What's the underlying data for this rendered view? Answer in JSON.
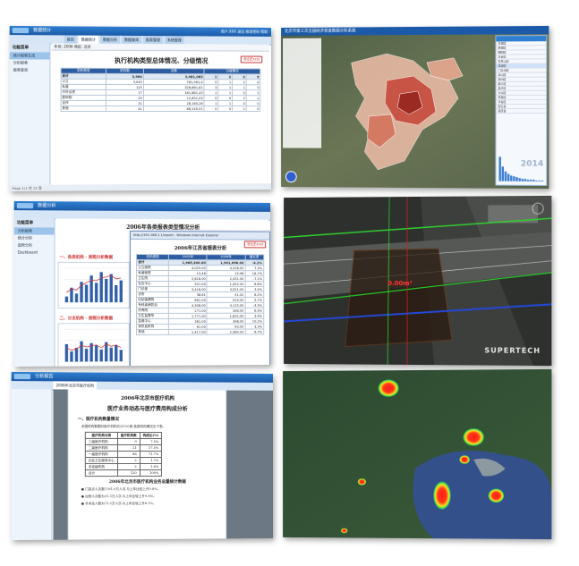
{
  "panel1": {
    "app_title": "数据统计",
    "header_links": "用户:XXX  退出  修改密码  帮助",
    "tabs": [
      "首页",
      "数据统计",
      "数据分析",
      "数据查询",
      "报表管理",
      "系统管理"
    ],
    "sidebar_head": "功能菜单",
    "sidebar_items": [
      "统计报表生成",
      "分析报表",
      "报表查询"
    ],
    "toolbar": "年份: 2006  地区: 北京",
    "report_title": "执行机构类型总体情况、分级情况",
    "export_label": "导出Excel",
    "col_headers": [
      "机构类型",
      "机构数",
      "总数",
      "分级情况",
      "",
      "",
      ""
    ],
    "rows": [
      [
        "合计",
        "3,964",
        "3,981,063",
        "1",
        "2",
        "3",
        "5"
      ],
      [
        "公立",
        "3,045",
        "781,581,4",
        "0",
        "1",
        "2",
        "4"
      ],
      [
        "私营",
        "125",
        "328,861,81",
        "3",
        "1",
        "1",
        "0"
      ],
      [
        "中外合资",
        "17",
        "161,881,43",
        "1",
        "1",
        "0",
        "1"
      ],
      [
        "股份制",
        "25",
        "12,831,03",
        "0",
        "0",
        "2",
        "1"
      ],
      [
        "合作",
        "31",
        "28,160,26",
        "1",
        "1",
        "0",
        "0"
      ],
      [
        "其他",
        "41",
        "88,140,01",
        "0",
        "0",
        "1",
        "0"
      ]
    ],
    "status": "Page 1/1  共 15 条"
  },
  "panel2": {
    "title": "北京市第三次全国经济普查数据分析系统",
    "year": "2014",
    "list_rows": [
      "东城区",
      "西城区",
      "朝阳区",
      "丰台区",
      "石景山区",
      "海淀区",
      "门头沟区",
      "房山区",
      "通州区",
      "顺义区",
      "昌平区",
      "大兴区",
      "怀柔区",
      "平谷区",
      "密云县",
      "延庆县"
    ]
  },
  "panel3": {
    "app_title": "数据分析",
    "sidebar_head": "功能菜单",
    "sidebar_items": [
      "分析报表",
      "统计分析",
      "趋势分析",
      "Dashboard"
    ],
    "main_title": "2006年各类报表类型情况分析",
    "section1": "一、各类机构 - 按照分析数据",
    "section2": "二、分支机构 - 按照分析数据",
    "overlay_bar": "http://192.168.1.1/report - Windows Internet Explorer",
    "overlay_title": "2006年江苏省报表分析",
    "export_label": "导出Excel",
    "overlay_headers": [
      "机构类型",
      "2005年",
      "2006年",
      "增长率"
    ],
    "overlay_rows": [
      [
        "合计",
        "1,985,300.00",
        "1,901,098.00",
        "-4.2%"
      ],
      [
        "公立医院",
        "4,025.00",
        "4,318.00",
        "7.3%"
      ],
      [
        "私营医院",
        "13.46",
        "15.98",
        "18.7%"
      ],
      [
        "卫生院",
        "2,618.00",
        "2,431.00",
        "-7.1%"
      ],
      [
        "社区中心",
        "921.00",
        "1,002.00",
        "8.8%"
      ],
      [
        "门诊部",
        "3,418.00",
        "3,521.00",
        "3.0%"
      ],
      [
        "诊所",
        "38.61",
        "41.02",
        "6.2%"
      ],
      [
        "妇幼保健院",
        "861.00",
        "910.00",
        "5.7%"
      ],
      [
        "专科疾病防治",
        "4,308.00",
        "4,115.00",
        "-4.5%"
      ],
      [
        "疗养院",
        "271.00",
        "288.00",
        "6.3%"
      ],
      [
        "卫生监督所",
        "1,771.00",
        "1,832.00",
        "3.4%"
      ],
      [
        "急救中心",
        "361.00",
        "398.00",
        "10.2%"
      ],
      [
        "采供血机构",
        "61.00",
        "63.00",
        "3.3%"
      ],
      [
        "其他",
        "2,417.00",
        "2,580.00",
        "6.7%"
      ]
    ],
    "chart1_values": [
      12,
      30,
      18,
      42,
      36,
      55,
      40,
      62,
      48,
      58,
      35,
      45
    ],
    "chart1_line": [
      20,
      28,
      25,
      35,
      40,
      46,
      44,
      50,
      52,
      55,
      48,
      50
    ],
    "chart2_values": [
      38,
      22,
      30,
      44,
      28,
      40,
      35,
      26,
      42,
      30,
      36,
      25
    ],
    "chart2_line": [
      30,
      25,
      28,
      35,
      32,
      34,
      36,
      30,
      38,
      33,
      35,
      30
    ]
  },
  "panel4": {
    "measure_label": "0.00m²",
    "brand": "SUPERTECH"
  },
  "panel5": {
    "app_title": "分析报告",
    "tab_label": "2006年北京市医疗机构",
    "title1": "2006年北京市医疗机构",
    "title2": "医疗业务动态与医疗费用构成分析",
    "section1": "一、医疗机构数量情况",
    "para1": "全国机构数据对医疗机构共计120家,各类机构情况见下表。",
    "table_headers": [
      "医疗机构分类",
      "医疗机构数",
      "构成比(%)"
    ],
    "table_rows": [
      [
        "三级医疗机构",
        "9",
        "7.5%"
      ],
      [
        "二级医疗机构",
        "21",
        "17.5%"
      ],
      [
        "一级医疗机构",
        "86",
        "71.7%"
      ],
      [
        "社区卫生服务中心",
        "2",
        "1.7%"
      ],
      [
        "未定级机构",
        "2",
        "1.6%"
      ],
      [
        "合计",
        "120",
        "100%"
      ]
    ],
    "section2": "2006年北京市医疗机构业务总量统计数据",
    "bullets": [
      "门急诊人次数1761.0万人次,与上年比较上升5.8%。",
      "出院人次数为31.3万人次,与上年比较上升9.8%。",
      "手术总人数为71.5万人次,与上年比较上升6.1%。"
    ]
  }
}
